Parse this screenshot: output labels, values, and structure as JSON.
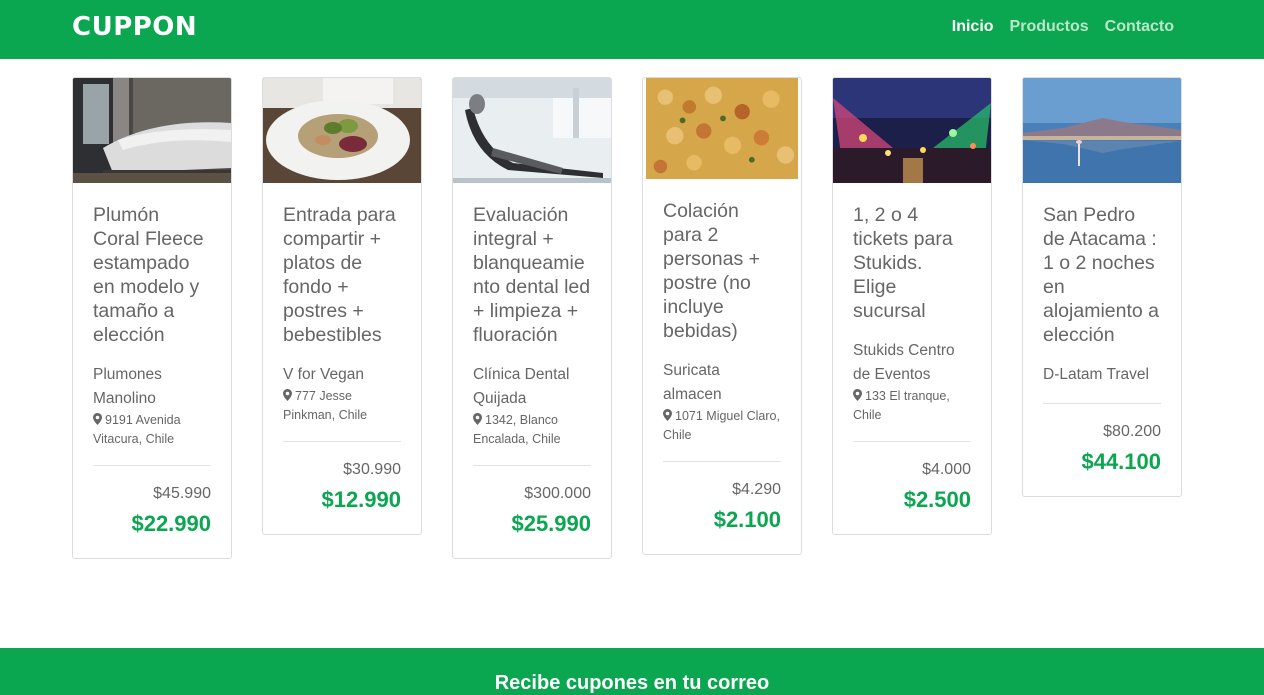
{
  "nav": {
    "brand": "CUPPON",
    "links": [
      "Inicio",
      "Productos",
      "Contacto"
    ]
  },
  "cards": [
    {
      "title": "Plumón Coral Fleece estampado en modelo y tamaño a elección",
      "merchant": "Plumones Manolino",
      "address": "9191 Avenida Vitacura, Chile",
      "price_old": "$45.990",
      "price_new": "$22.990",
      "image": "bedroom-image"
    },
    {
      "title": "Entrada para compartir + platos de fondo + postres + bebestibles",
      "merchant": "V for Vegan",
      "address": "777 Jesse Pinkman, Chile",
      "price_old": "$30.990",
      "price_new": "$12.990",
      "image": "salad-image"
    },
    {
      "title": "Evaluación integral + blanqueamiento dental led + limpieza + fluoración",
      "merchant": "Clínica Dental Quijada",
      "address": "1342, Blanco Encalada, Chile",
      "price_old": "$300.000",
      "price_new": "$25.990",
      "image": "dental-chair-image"
    },
    {
      "title": "Colación para 2 personas + postre (no incluye bebidas)",
      "merchant": "Suricata almacen",
      "address": "1071 Miguel Claro, Chile",
      "price_old": "$4.290",
      "price_new": "$2.100",
      "image": "chickpea-stew-image"
    },
    {
      "title": "1, 2 o 4 tickets para Stukids. Elige sucursal",
      "merchant": "Stukids Centro de Eventos",
      "address": "133 El tranque, Chile",
      "price_old": "$4.000",
      "price_new": "$2.500",
      "image": "fair-lights-image"
    },
    {
      "title": "San Pedro de Atacama : 1 o 2 noches en alojamiento a elección",
      "merchant": "D-Latam Travel",
      "address": "",
      "price_old": "$80.200",
      "price_new": "$44.100",
      "image": "atacama-lake-image"
    }
  ],
  "footer": {
    "title": "Recibe cupones en tu correo"
  },
  "colors": {
    "brand_green": "#0aa650",
    "nav_inactive": "#b9e6c9"
  },
  "icons": {
    "pin": "map-marker-icon"
  }
}
